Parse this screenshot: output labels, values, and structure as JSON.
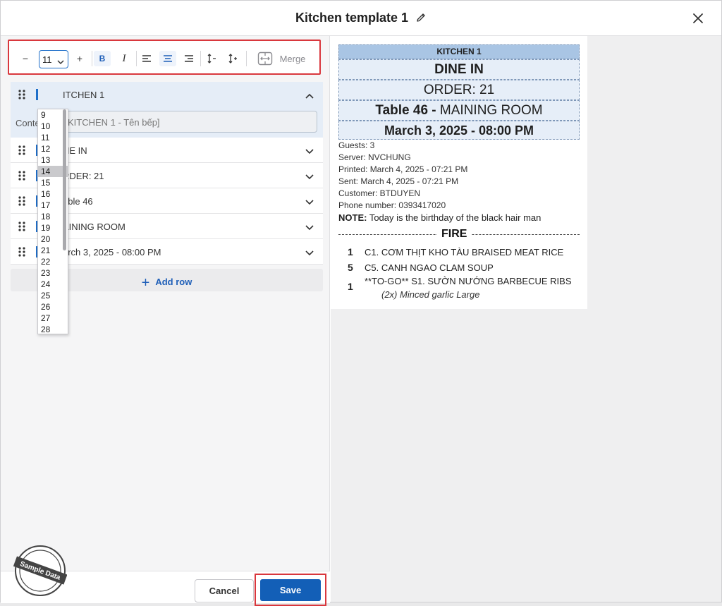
{
  "header": {
    "title": "Kitchen template 1"
  },
  "toolbar": {
    "minus": "−",
    "size_value": "11",
    "plus": "+",
    "bold": "B",
    "italic": "I",
    "merge_label": "Merge"
  },
  "font_size_options": [
    "9",
    "10",
    "11",
    "12",
    "13",
    "14",
    "15",
    "16",
    "17",
    "18",
    "19",
    "20",
    "21",
    "22",
    "23",
    "24",
    "25",
    "26",
    "27",
    "28"
  ],
  "font_size_highlighted": "14",
  "rows": [
    {
      "label": "ITCHEN 1",
      "content_label": "Conte",
      "content_value": "KITCHEN 1 - Tên bếp]"
    },
    {
      "label": "NE IN"
    },
    {
      "label": "RDER: 21"
    },
    {
      "label": "able 46"
    },
    {
      "label": "AINING ROOM"
    },
    {
      "label": "arch 3, 2025 - 08:00 PM"
    }
  ],
  "add_row_label": "Add row",
  "footer": {
    "cancel_label": "Cancel",
    "save_label": "Save"
  },
  "watermark": "Sample Data",
  "preview": {
    "kitchen": "KITCHEN 1",
    "dine": "DINE IN",
    "order": "ORDER: 21",
    "table_bold": "Table 46 - ",
    "table_rest": "MAINING ROOM",
    "datetime": "March 3, 2025 - 08:00 PM",
    "guests": "Guests:  3",
    "server": "Server:  NVCHUNG",
    "printed": "Printed:  March 4, 2025 - 07:21 PM",
    "sent": "Sent:  March 4, 2025 - 07:21 PM",
    "customer": "Customer:  BTDUYEN",
    "phone": "Phone number:  0393417020",
    "note_label": "NOTE:",
    "note_text": " Today is the birthday of the black hair man",
    "fire": "FIRE",
    "items": [
      {
        "qty": "1",
        "name": "C1. CƠM THỊT KHO TÀU BRAISED MEAT RICE"
      },
      {
        "qty": "5",
        "name": "C5. CANH NGAO CLAM SOUP"
      },
      {
        "qty": "1",
        "name": "**TO-GO** S1. SƯỜN NƯỚNG BARBECUE RIBS"
      }
    ],
    "modifier": "(2x) Minced garlic Large"
  },
  "colors": {
    "accent": "#135fb7",
    "highlight_border": "#d9373d",
    "header_cell": "#a9c5e4",
    "cell_bg": "#e6eef8"
  }
}
